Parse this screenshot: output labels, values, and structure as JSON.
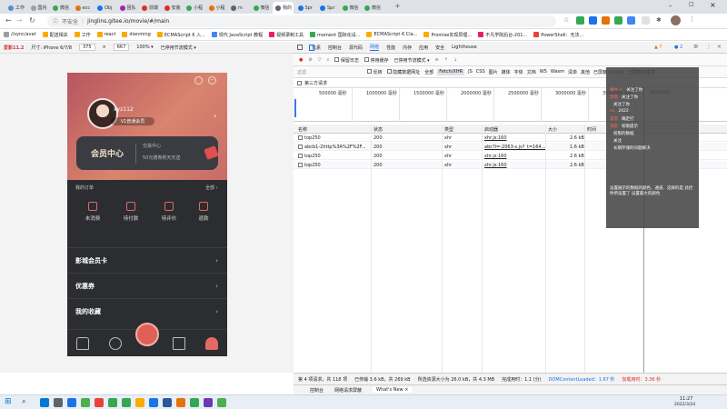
{
  "browser": {
    "tabs": [
      {
        "label": "工作",
        "color": "#4a90d9"
      },
      {
        "label": "国内",
        "color": "#9aa0a6"
      },
      {
        "label": "微信",
        "color": "#34a853"
      },
      {
        "label": "ecc",
        "color": "#e8710a"
      },
      {
        "label": "Obj",
        "color": "#1a73e8"
      },
      {
        "label": "团队",
        "color": "#9c27b0"
      },
      {
        "label": "前端",
        "color": "#d93025"
      },
      {
        "label": "安装",
        "color": "#d93025"
      },
      {
        "label": "小程",
        "color": "#34a853"
      },
      {
        "label": "小程",
        "color": "#e8710a"
      },
      {
        "label": "m",
        "color": "#5f6368"
      },
      {
        "label": "微信",
        "color": "#34a853"
      },
      {
        "label": "我的",
        "color": "#5f6368",
        "active": true
      },
      {
        "label": "Spr",
        "color": "#1a73e8"
      },
      {
        "label": "Spr",
        "color": "#1a73e8"
      },
      {
        "label": "微信",
        "color": "#34a853"
      },
      {
        "label": "微信",
        "color": "#34a853"
      }
    ],
    "new_tab": "+",
    "security": "不安全",
    "url": "jinglins.gitee.io/movie/#/main",
    "bookmarks": [
      {
        "label": "//sync/avat",
        "color": "#9e9e9e"
      },
      {
        "label": "配送相关",
        "color": "#f9ab00"
      },
      {
        "label": "工作",
        "color": "#f9ab00"
      },
      {
        "label": "react",
        "color": "#f9ab00"
      },
      {
        "label": "dianming",
        "color": "#f9ab00"
      },
      {
        "label": "ECMAScript 6 入...",
        "color": "#f9ab00"
      },
      {
        "label": "现代 JavaScript 教程",
        "color": "#4285f4"
      },
      {
        "label": "视频录制工具",
        "color": "#e91e63"
      },
      {
        "label": "moment 国际化设...",
        "color": "#34a853"
      },
      {
        "label": "ECMAScript 6 Cla...",
        "color": "#f9ab00"
      },
      {
        "label": "Promise实现原理...",
        "color": "#f9ab00"
      },
      {
        "label": "不凡学院后台-201...",
        "color": "#e91e63"
      },
      {
        "label": "PowerShell：无法...",
        "color": "#ea4335"
      }
    ]
  },
  "device_toolbar": {
    "device": "尺寸: iPhone 6/7/8",
    "width": "375",
    "times": "×",
    "height": "667",
    "zoom": "100% ▾",
    "throttle": "已停用节流模式 ▾"
  },
  "phone": {
    "username": "xyz112",
    "level": "V1普通会员",
    "vip_title": "会员中心",
    "vip_line1": "交易中心",
    "vip_line2": "50元赠券新天天送",
    "orders_label": "我的订单",
    "orders_all": "全部 ›",
    "order_items": [
      "未消费",
      "待付款",
      "待评价",
      "退款"
    ],
    "menus": [
      "影城会员卡",
      "优惠券",
      "我的收藏"
    ],
    "arrow": "›"
  },
  "devtools": {
    "tabs": [
      "元素",
      "控制台",
      "源代码",
      "网络",
      "性能",
      "内存",
      "应用",
      "安全",
      "Lighthouse"
    ],
    "selected_tab": "网络",
    "errors_badge": "▲ 7",
    "issues_badge": "● 2",
    "preserve_log": "保留日志",
    "disable_cache": "停用缓存",
    "throttle": "已停用节流模式 ▾",
    "filter_placeholder": "过滤",
    "invert": "反转",
    "hide_data_urls": "隐藏数据网址",
    "filter_types": [
      "全部",
      "Fetch/XHR",
      "JS",
      "CSS",
      "图片",
      "媒体",
      "字体",
      "文档",
      "WS",
      "Wasm",
      "清单",
      "其他",
      "已屏蔽 Cookie",
      "已屏蔽的请求"
    ],
    "selected_filter": "Fetch/XHR",
    "third_party": "第三方请求",
    "timeline_ticks": [
      "500000 毫秒",
      "1000000 毫秒",
      "1500000 毫秒",
      "2000000 毫秒",
      "2500000 毫秒",
      "3000000 毫秒",
      "3500000 毫秒",
      "4000000"
    ],
    "columns": [
      "名称",
      "状态",
      "类型",
      "启动器",
      "大小",
      "时间"
    ],
    "rows": [
      {
        "name": "top250",
        "status": "200",
        "type": "xhr",
        "initiator": "xhr.js:160",
        "size": "2.6 kB"
      },
      {
        "name": "abcb1-2http%3A%2F%2F...",
        "status": "200",
        "type": "xhr",
        "initiator": "abc?i=-2063-s.js?_t=164...",
        "size": "1.6 kB"
      },
      {
        "name": "top250",
        "status": "200",
        "type": "xhr",
        "initiator": "xhr.js:160",
        "size": "2.6 kB"
      },
      {
        "name": "top250",
        "status": "200",
        "type": "xhr",
        "initiator": "xhr.js:160",
        "size": "2.6 kB"
      }
    ],
    "status": {
      "requests": "第 4 项请求，共 118 项",
      "transferred": "已传输 3.6 kB，共 269 kB",
      "resources": "所选资源大小为 26.0 kB，共 4.3 MB",
      "finish": "完成用时：1.1 (分)",
      "dcl": "DOMContentLoaded：1.67 秒",
      "load": "加载用时：3.36 秒"
    },
    "drawer_tabs": [
      "控制台",
      "网络请求屏蔽",
      "What's New ×"
    ]
  },
  "overlay": {
    "lines": [
      {
        "k": "",
        "v": "",
        "t": ""
      },
      {
        "k": "事件 ×",
        "v": "",
        "t": "关注了你"
      },
      {
        "k": "消息",
        "v": "",
        "t": "关注了你"
      },
      {
        "k": "",
        "v": "",
        "t": "关注了你"
      },
      {
        "k": "xx",
        "v": "",
        "t": "2022"
      },
      {
        "k": "消息",
        "v": "",
        "t": "确定打"
      },
      {
        "k": "消息",
        "v": "",
        "t": "权限提示"
      },
      {
        "k": "",
        "v": "",
        "t": "权限的数据"
      },
      {
        "k": "",
        "v": "",
        "t": "关注"
      },
      {
        "k": "",
        "v": "",
        "t": "长期存储的问题解决"
      }
    ],
    "footer": "设置展示的数据的颜色、通道、选择的是 此控件所设置了 设置最大的颜色"
  },
  "taskbar": {
    "time": "11:27",
    "date": "2022/3/24",
    "colors": [
      "#0078d4",
      "#5f6368",
      "#1a73e8",
      "#4caf50",
      "#ea4335",
      "#34a853",
      "#34a853",
      "#f9ab00",
      "#1a73e8",
      "#2b579a",
      "#e8710a",
      "#34a853",
      "#673ab7",
      "#4caf50"
    ]
  }
}
